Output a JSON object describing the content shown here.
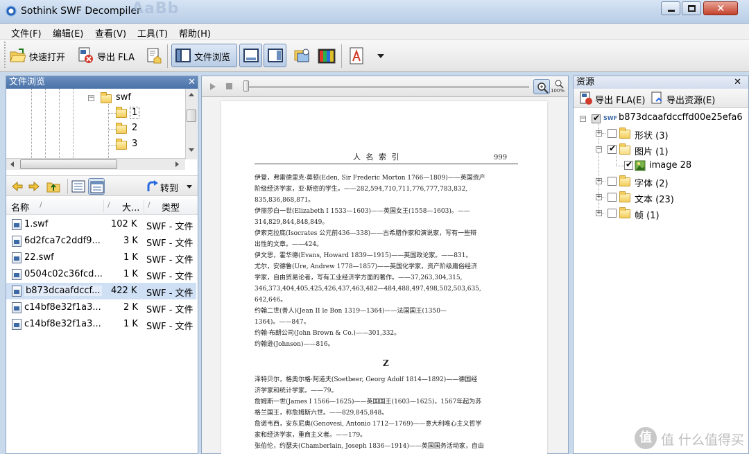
{
  "window": {
    "title": "Sothink SWF Decompiler",
    "background_ghost_text": "AaBb"
  },
  "menu": [
    "文件(F)",
    "编辑(E)",
    "查看(V)",
    "工具(T)",
    "帮助(H)"
  ],
  "toolbar": {
    "quick_open": "快速打开",
    "export_fla": "导出 FLA",
    "file_browse": "文件浏览"
  },
  "file_browser": {
    "title": "文件浏览",
    "tree": {
      "root": "swf",
      "children": [
        "1",
        "2",
        "3"
      ]
    },
    "nav": {
      "goto": "转到"
    },
    "columns": {
      "name": "名称",
      "size": "大...",
      "type": "类型"
    },
    "files": [
      {
        "name": "1.swf",
        "size": "102 K",
        "type": "SWF - 文件"
      },
      {
        "name": "6d2fca7c2ddf9...",
        "size": "3 K",
        "type": "SWF - 文件"
      },
      {
        "name": "22.swf",
        "size": "1 K",
        "type": "SWF - 文件"
      },
      {
        "name": "0504c02c36fcd...",
        "size": "1 K",
        "type": "SWF - 文件"
      },
      {
        "name": "b873dcaafdccf...",
        "size": "422 K",
        "type": "SWF - 文件"
      },
      {
        "name": "c14bf8e32f1a3...",
        "size": "2 K",
        "type": "SWF - 文件"
      },
      {
        "name": "c14bf8e32f1a3...",
        "size": "1 K",
        "type": "SWF - 文件"
      }
    ],
    "selected_index": 4
  },
  "preview": {
    "zoom_label": "100%",
    "page": {
      "header": "人 名 索 引",
      "page_number": "999",
      "section_letter": "Z",
      "lines_a": [
        "伊登，弗雷德里克·莫顿(Eden, Sir Frederic Morton 1766—1809)——英国资产",
        "    阶级经济学家，亚·斯密的学生。——282,594,710,711,776,777,783,832,",
        "    835,836,868,871。",
        "伊丽莎白一世(Elizabeth I 1533—1603)——英国女王(1558—1603)。——",
        "    314,829,844,848,849。",
        "伊索克拉底(Isocrates 公元前436—338)——古希腊作家和演说家，写有一些辩",
        "    出性的文章。——424。",
        "伊文思，霍华德(Evans, Howard 1839—1915)——英国政论家。——831。",
        "尤尔，安德鲁(Ure, Andrew 1778—1857)——英国化学家，资产阶级庸俗经济",
        "    学家，自由贸易论者，写有工业经济学方面的著作。——37,263,304,315,",
        "    346,373,404,405,425,426,437,463,482—484,488,497,498,502,503,635,",
        "    642,646。",
        "约翰二世(善人)(Jean II le Bon 1319—1364)——法国国王(1350—",
        "    1364)。——847。",
        "约翰·布朗公司(John Brown & Co.)——301,332。",
        "约翰逊(Johnson)——816。"
      ],
      "lines_b": [
        "泽特贝尔，格奥尔格·阿道夫(Soetbeer, Georg Adolf 1814—1892)——德国经",
        "    济学家和统计学家。——79。",
        "詹姆斯一世(James I 1566—1625)——英国国王(1603—1625)，1567年起为苏",
        "    格兰国王，称詹姆斯六世。——829,845,848。",
        "詹诺韦西，安东尼奥(Genovesi, Antonio 1712—1769)——意大利唯心主义哲学",
        "    家和经济学家，重商主义者。——179。",
        "张伯伦，约瑟夫(Chamberlain, Joseph 1836—1914)——英国国务活动家，自由"
      ]
    }
  },
  "resources": {
    "title": "资源",
    "export_fla": "导出 FLA(E)",
    "export_resources": "导出资源(E)",
    "root": "b873dcaafdccffd00e25efa6",
    "root_badge": "SWF",
    "items": [
      {
        "label": "形状 (3)",
        "checked": false,
        "expanded": false
      },
      {
        "label": "图片 (1)",
        "checked": true,
        "expanded": true
      },
      {
        "label": "image 28",
        "checked": true,
        "child": true
      },
      {
        "label": "字体 (2)",
        "checked": false,
        "expanded": false
      },
      {
        "label": "文本 (23)",
        "checked": false,
        "expanded": false
      },
      {
        "label": "帧 (1)",
        "checked": false,
        "expanded": false
      }
    ]
  },
  "watermark": "值 什么值得买",
  "colors": {
    "panel_header": "#4a72a8",
    "window_frame": "#c9d9ec",
    "selected_row": "#cfe0f5"
  }
}
